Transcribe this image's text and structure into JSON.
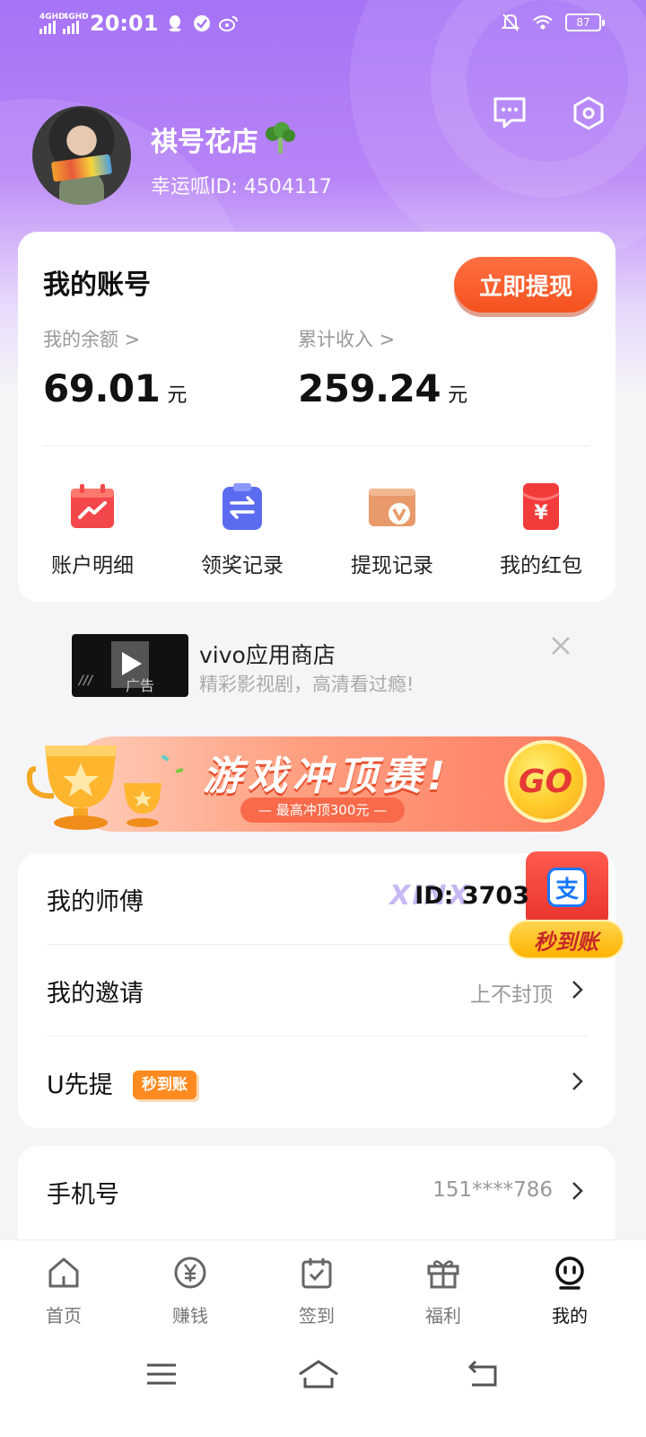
{
  "status_bar": {
    "net1": "4GHD",
    "net2": "4GHD",
    "time": "20:01",
    "battery": "87"
  },
  "profile": {
    "name": "祺号花店",
    "id_text": "幸运呱ID: 4504117"
  },
  "account": {
    "title": "我的账号",
    "withdraw_label": "立即提现",
    "balance_label": "我的余额 >",
    "balance_value": "69.01",
    "balance_unit": "元",
    "income_label": "累计收入 >",
    "income_value": "259.24",
    "income_unit": "元",
    "quick_actions": [
      {
        "label": "账户明细",
        "icon": "trend-calendar-icon",
        "color": "#f4474b"
      },
      {
        "label": "领奖记录",
        "icon": "clipboard-swap-icon",
        "color": "#5b6cf0"
      },
      {
        "label": "提现记录",
        "icon": "wallet-v-icon",
        "color": "#e99a6a"
      },
      {
        "label": "我的红包",
        "icon": "red-envelope-icon",
        "color": "#f23c3c"
      }
    ]
  },
  "ad": {
    "title": "vivo应用商店",
    "subtitle": "精彩影视剧，高清看过瘾!",
    "tag": "广告"
  },
  "banner": {
    "title": "游戏冲顶赛!",
    "subtitle": "— 最高冲顶300元 —",
    "go": "GO"
  },
  "menu": {
    "master": {
      "label": "我的师傅",
      "ghost": "XINX",
      "value": "ID: 3703"
    },
    "invite": {
      "label": "我的邀请",
      "value": "上不封顶"
    },
    "uwithdraw": {
      "label": "U先提",
      "badge": "秒到账"
    },
    "phone": {
      "label": "手机号",
      "value": "151****786"
    }
  },
  "float_pay": {
    "glyph": "支",
    "label": "秒到账"
  },
  "tabbar": {
    "items": [
      {
        "label": "首页",
        "icon": "home-icon"
      },
      {
        "label": "赚钱",
        "icon": "yuan-coin-icon"
      },
      {
        "label": "签到",
        "icon": "calendar-check-icon"
      },
      {
        "label": "福利",
        "icon": "gift-icon"
      },
      {
        "label": "我的",
        "icon": "mine-face-icon"
      }
    ],
    "active_index": 4
  },
  "colors": {
    "accent": "#f4511e",
    "header_purple": "#a573f6",
    "badge_orange": "#ff8a1f"
  }
}
